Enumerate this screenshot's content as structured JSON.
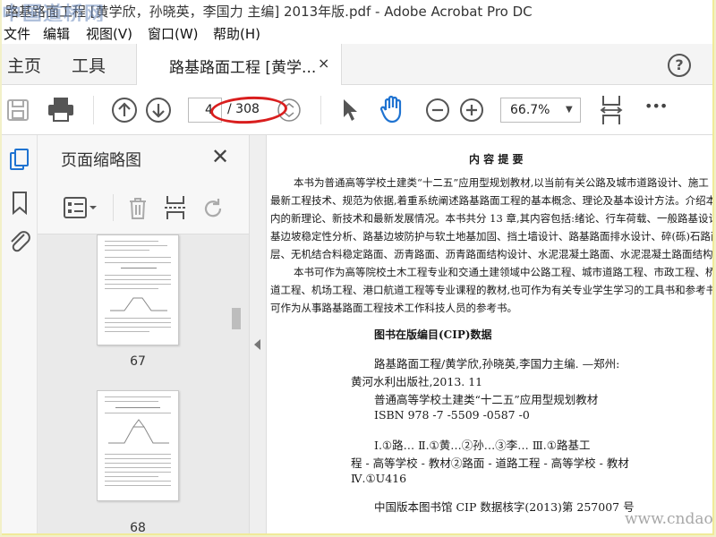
{
  "window": {
    "title": "路基路面工程 [黄学欣，孙晓英，李国力 主编] 2013年版.pdf - Adobe Acrobat Pro DC",
    "watermark_top": "中国道桥网"
  },
  "menu": [
    "文件",
    "编辑",
    "视图(V)",
    "窗口(W)",
    "帮助(H)"
  ],
  "tabs": {
    "home": "主页",
    "tools": "工具",
    "document": "路基路面工程 [黄学...",
    "close_glyph": "×",
    "help_glyph": "?"
  },
  "toolbar": {
    "current_page": "4",
    "total_pages": "/ 308",
    "zoom": "66.7%",
    "more": "•••"
  },
  "panel": {
    "title": "页面缩略图",
    "close_glyph": "✕",
    "thumbnails": [
      {
        "number": "67"
      },
      {
        "number": "68"
      }
    ]
  },
  "document": {
    "heading": "内 容 提 要",
    "summary_lines": [
      "本书为普通高等学校土建类“十二五”应用型规划教材,以当前有关公路及城市道路设计、施工",
      "最新工程技术、规范为依据,着重系统阐述路基路面工程的基本概念、理论及基本设计方法。介绍本领",
      "内的新理论、新技术和最新发展情况。本书共分 13 章,其内容包括:绪论、行车荷载、一般路基设计、",
      "基边坡稳定性分析、路基边坡防护与软土地基加固、挡土墙设计、路基路面排水设计、碎(砾)石路面与",
      "层、无机结合料稳定路面、沥青路面、沥青路面结构设计、水泥混凝土路面、水泥混凝土路面结构设计",
      "本书可作为高等院校土木工程专业和交通土建领域中公路工程、城市道路工程、市政工程、桥梁",
      "道工程、机场工程、港口航道工程等专业课程的教材,也可作为有关专业学生学习的工具书和参考书,",
      "可作为从事路基路面工程技术工作科技人员的参考书。"
    ],
    "cip_heading": "图书在版编目(CIP)数据",
    "cip_lines": [
      "路基路面工程/黄学欣,孙晓英,李国力主编. —郑州:",
      "黄河水利出版社,2013. 11",
      "普通高等学校土建类“十二五”应用型规划教材",
      "ISBN 978 -7 -5509 -0587 -0",
      "Ⅰ.①路…   Ⅱ.①黄…②孙…③李…   Ⅲ.①路基工",
      "程 - 高等学校 - 教材②路面 - 道路工程 - 高等学校 - 教材",
      "Ⅳ.①U416",
      "中国版本图书馆 CIP 数据核字(2013)第 257007 号"
    ],
    "watermark_bottom": "www.cndao.com"
  },
  "colors": {
    "annotation_oval": "#d91e1e",
    "page_bg": "#ffffff",
    "chrome_bg": "#f4f4f4"
  }
}
